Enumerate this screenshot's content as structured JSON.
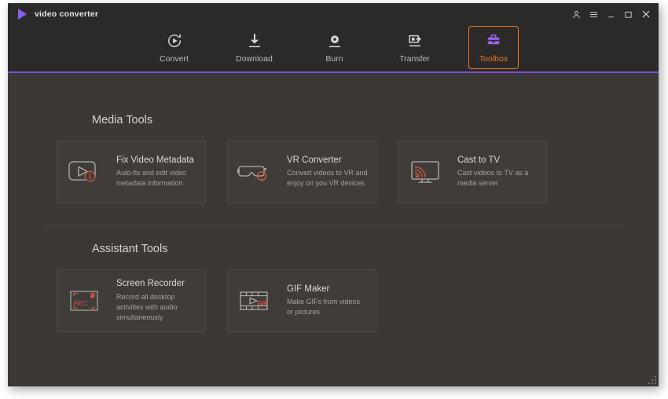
{
  "window": {
    "title": "video converter",
    "logo_icon": "play-triangle-logo",
    "controls": [
      {
        "name": "account-icon",
        "glyph": "person"
      },
      {
        "name": "menu-icon",
        "glyph": "hamburger"
      },
      {
        "name": "minimize-icon",
        "glyph": "minimize"
      },
      {
        "name": "maximize-icon",
        "glyph": "maximize"
      },
      {
        "name": "close-icon",
        "glyph": "close"
      }
    ]
  },
  "nav": {
    "active": "Toolbox",
    "accent_color": "#7c4dde",
    "active_color": "#e8791e",
    "items": [
      {
        "label": "Convert",
        "icon": "convert-circular-arrow-play-icon"
      },
      {
        "label": "Download",
        "icon": "download-arrow-icon"
      },
      {
        "label": "Burn",
        "icon": "burn-disc-icon"
      },
      {
        "label": "Transfer",
        "icon": "transfer-device-icon"
      },
      {
        "label": "Toolbox",
        "icon": "toolbox-icon"
      }
    ]
  },
  "sections": [
    {
      "title": "Media Tools",
      "cards": [
        {
          "title": "Fix Video Metadata",
          "desc": "Auto-fix and edit video metadata information",
          "icon": "video-frame-info-icon"
        },
        {
          "title": "VR Converter",
          "desc": "Convert videos to VR and enjoy on you VR devices",
          "icon": "vr-headset-icon"
        },
        {
          "title": "Cast to TV",
          "desc": "Cast videos to TV as a media server",
          "icon": "tv-cast-icon"
        }
      ]
    },
    {
      "title": "Assistant Tools",
      "cards": [
        {
          "title": "Screen Recorder",
          "desc": "Record all desktop activities with audio simultaneously",
          "icon": "screen-recorder-icon",
          "badge_text": "REC"
        },
        {
          "title": "GIF Maker",
          "desc": "Make GIFs from videos or pictures",
          "icon": "gif-film-icon",
          "badge_text": "GIF"
        }
      ]
    }
  ]
}
